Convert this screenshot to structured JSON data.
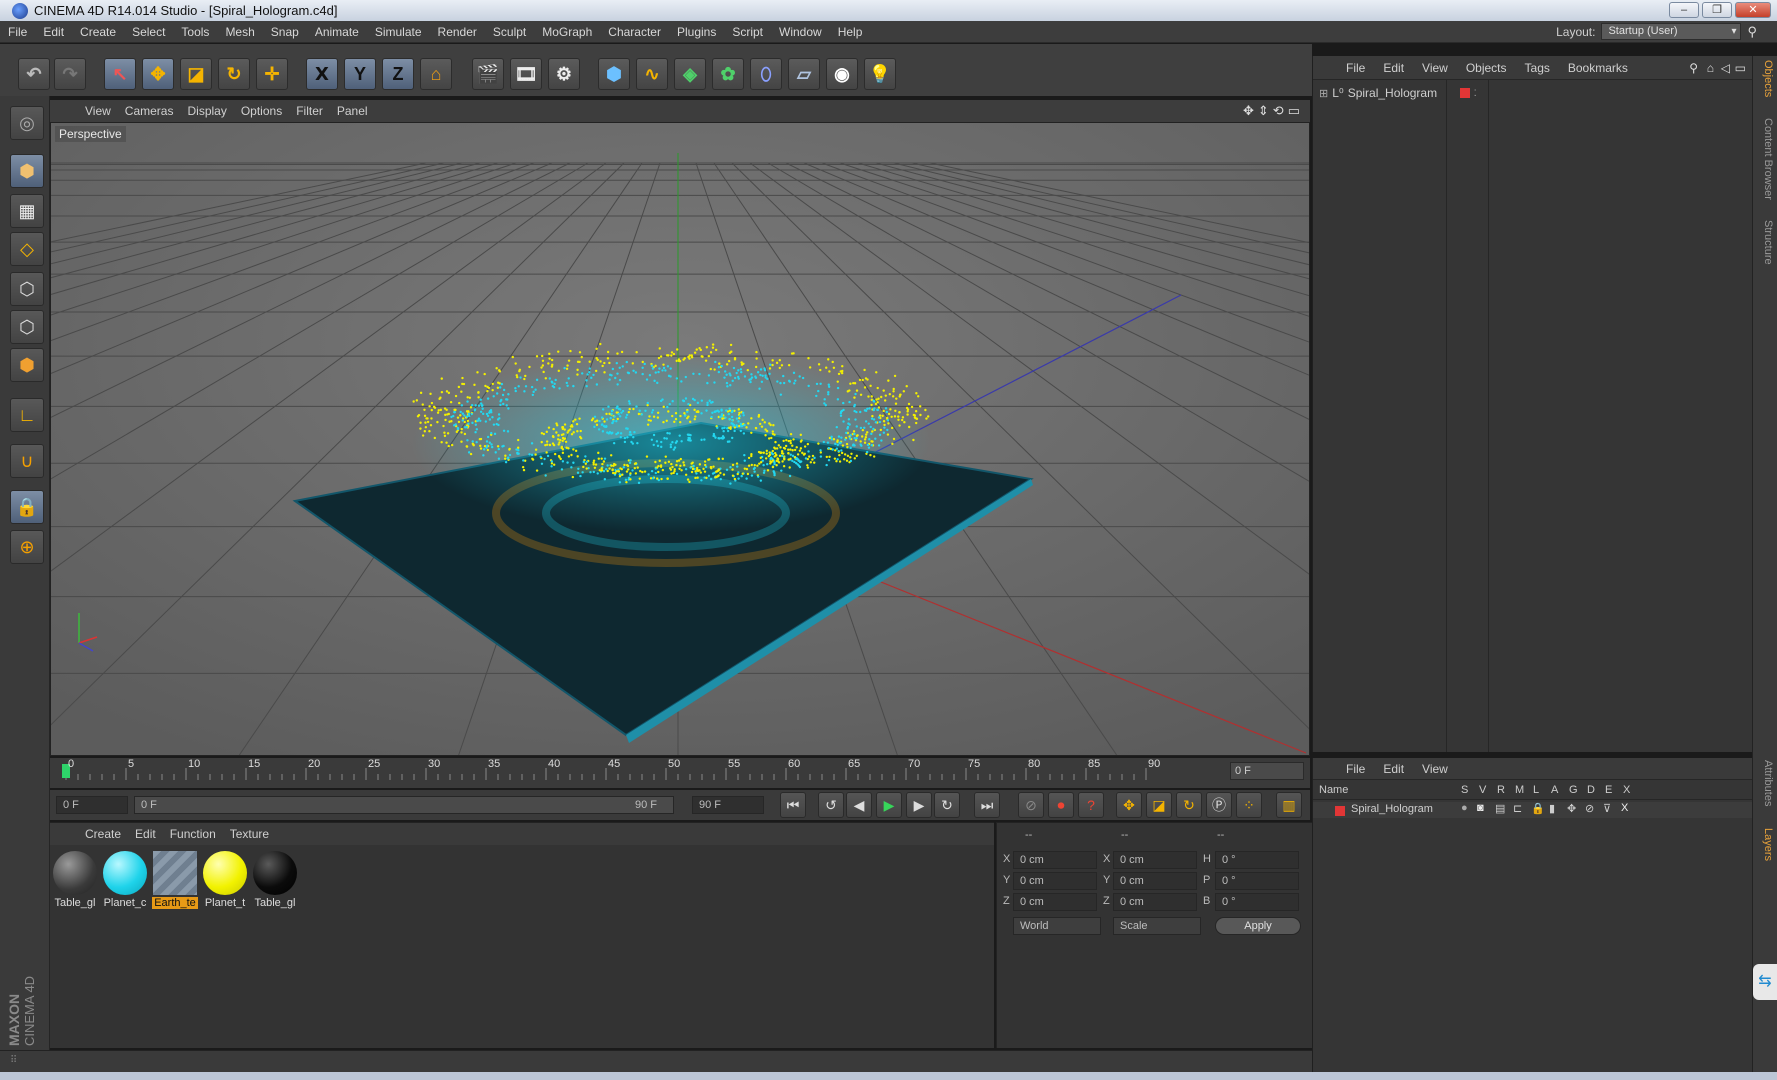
{
  "window": {
    "title": "CINEMA 4D R14.014 Studio - [Spiral_Hologram.c4d]",
    "controls": [
      "–",
      "❐",
      "✕"
    ]
  },
  "menubar": {
    "items": [
      "File",
      "Edit",
      "Create",
      "Select",
      "Tools",
      "Mesh",
      "Snap",
      "Animate",
      "Simulate",
      "Render",
      "Sculpt",
      "MoGraph",
      "Character",
      "Plugins",
      "Script",
      "Window",
      "Help"
    ],
    "layout_label": "Layout:",
    "layout_value": "Startup (User)"
  },
  "toolbar": {
    "axis_x": "X",
    "axis_y": "Y",
    "axis_z": "Z"
  },
  "viewport": {
    "menu": [
      "View",
      "Cameras",
      "Display",
      "Options",
      "Filter",
      "Panel"
    ],
    "label": "Perspective"
  },
  "timeline": {
    "ticks": [
      "0",
      "5",
      "10",
      "15",
      "20",
      "25",
      "30",
      "35",
      "40",
      "45",
      "50",
      "55",
      "60",
      "65",
      "70",
      "75",
      "80",
      "85",
      "90"
    ],
    "current_frame": "0 F",
    "start_field": "0 F",
    "range_start": "0 F",
    "range_end": "90 F",
    "end_field": "90 F"
  },
  "materials": {
    "menu": [
      "Create",
      "Edit",
      "Function",
      "Texture"
    ],
    "items": [
      {
        "label": "Table_gl",
        "color": "#4a4a4a"
      },
      {
        "label": "Planet_c",
        "color": "#1fd3ea"
      },
      {
        "label": "Earth_te",
        "color": "#8a9aaa"
      },
      {
        "label": "Planet_t",
        "color": "#f2f200"
      },
      {
        "label": "Table_gl",
        "color": "#0b0b0b"
      }
    ]
  },
  "coordinates": {
    "headers": [
      "--",
      "--",
      "--"
    ],
    "rows": [
      {
        "a": "X",
        "av": "0 cm",
        "b": "X",
        "bv": "0 cm",
        "c": "H",
        "cv": "0 °"
      },
      {
        "a": "Y",
        "av": "0 cm",
        "b": "Y",
        "bv": "0 cm",
        "c": "P",
        "cv": "0 °"
      },
      {
        "a": "Z",
        "av": "0 cm",
        "b": "Z",
        "bv": "0 cm",
        "c": "B",
        "cv": "0 °"
      }
    ],
    "space": "World",
    "mode": "Scale",
    "apply": "Apply"
  },
  "objects_panel": {
    "menu": [
      "File",
      "Edit",
      "View",
      "Objects",
      "Tags",
      "Bookmarks"
    ],
    "object_name": "Spiral_Hologram"
  },
  "layers_panel": {
    "menu": [
      "File",
      "Edit",
      "View"
    ],
    "columns_name": "Name",
    "columns": [
      "S",
      "V",
      "R",
      "M",
      "L",
      "A",
      "G",
      "D",
      "E",
      "X"
    ],
    "layer_name": "Spiral_Hologram"
  },
  "sidetabs": [
    "Objects",
    "Content Browser",
    "Structure",
    "Attributes",
    "Layers"
  ],
  "brand": {
    "maker": "MAXON",
    "product": "CINEMA 4D"
  },
  "colors": {
    "accent": "#e89a16",
    "particles_cyan": "#23d7f0",
    "particles_yellow": "#f3f000",
    "viewport_bg": "#6e6e6e"
  }
}
